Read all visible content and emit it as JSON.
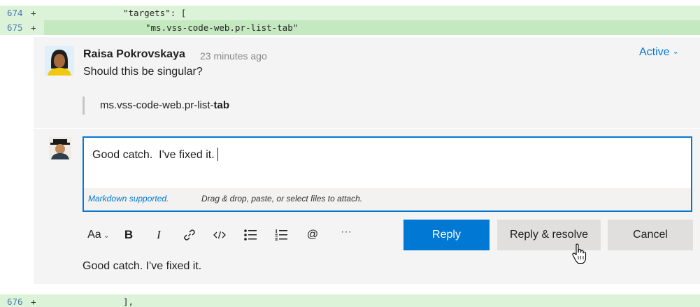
{
  "diff": {
    "lines": [
      {
        "num": "674",
        "sign": "+",
        "code": "\"targets\": ["
      },
      {
        "num": "675",
        "sign": "+",
        "code": "\"ms.vss-code-web.pr-list-tab\""
      },
      {
        "num": "676",
        "sign": "+",
        "code": "],"
      }
    ]
  },
  "thread": {
    "author": "Raisa Pokrovskaya",
    "time": "23 minutes ago",
    "comment": "Should this be singular?",
    "quote_prefix": "ms.vss-code-web.pr-list-",
    "quote_bold": "tab",
    "status": "Active"
  },
  "reply": {
    "text": "Good catch.  I've fixed it.",
    "markdown_link": "Markdown supported.",
    "attach_hint": "Drag & drop, paste, or select files to attach.",
    "preview": "Good catch. I've fixed it."
  },
  "toolbar": {
    "font_size": "Aa",
    "bold": "B",
    "italic": "I",
    "mention": "@",
    "more": "···"
  },
  "buttons": {
    "reply": "Reply",
    "reply_resolve": "Reply & resolve",
    "cancel": "Cancel"
  },
  "colors": {
    "accent": "#0078d4",
    "diff_added": "#ddf3d9"
  }
}
